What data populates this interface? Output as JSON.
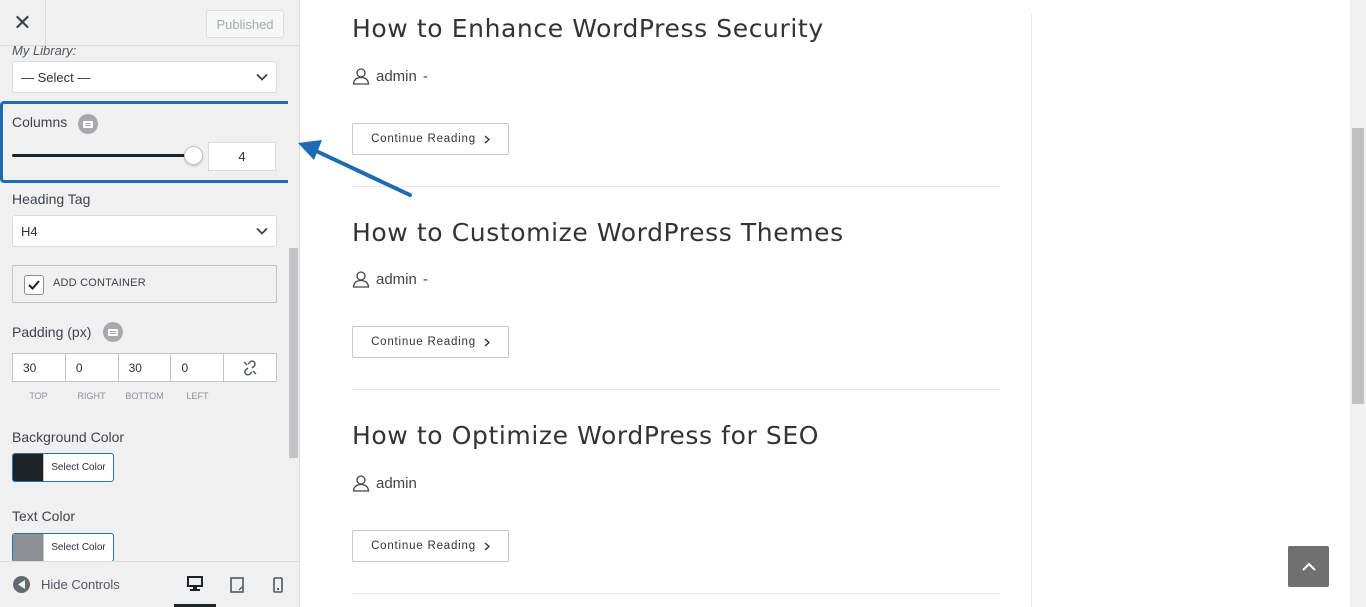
{
  "header": {
    "close_icon": "close-icon",
    "published_label": "Published"
  },
  "library": {
    "label": "My Library:",
    "select_value": "— Select —"
  },
  "columns": {
    "label": "Columns",
    "value": "4",
    "slider_fraction": 0.95
  },
  "heading_tag": {
    "label": "Heading Tag",
    "value": "H4"
  },
  "container": {
    "label": "ADD CONTAINER",
    "checked": true
  },
  "padding": {
    "label": "Padding (px)",
    "values": {
      "top": "30",
      "right": "0",
      "bottom": "30",
      "left": "0"
    },
    "captions": [
      "TOP",
      "RIGHT",
      "BOTTOM",
      "LEFT"
    ]
  },
  "background_color": {
    "label": "Background Color",
    "button": "Select Color",
    "swatch": "#1d2327"
  },
  "text_color": {
    "label": "Text Color",
    "button": "Select Color",
    "swatch": "#8c8f94"
  },
  "footer": {
    "hide_label": "Hide Controls",
    "devices": [
      "desktop",
      "tablet",
      "mobile"
    ]
  },
  "posts": [
    {
      "title": "How to Enhance WordPress Security",
      "author": "admin",
      "separator": "-",
      "button": "Continue Reading"
    },
    {
      "title": "How to Customize WordPress Themes",
      "author": "admin",
      "separator": "-",
      "button": "Continue Reading"
    },
    {
      "title": "How to Optimize WordPress for SEO",
      "author": "admin",
      "separator": "",
      "button": "Continue Reading"
    }
  ],
  "colors": {
    "highlight": "#1e6bb0",
    "accent": "#2271b1"
  }
}
